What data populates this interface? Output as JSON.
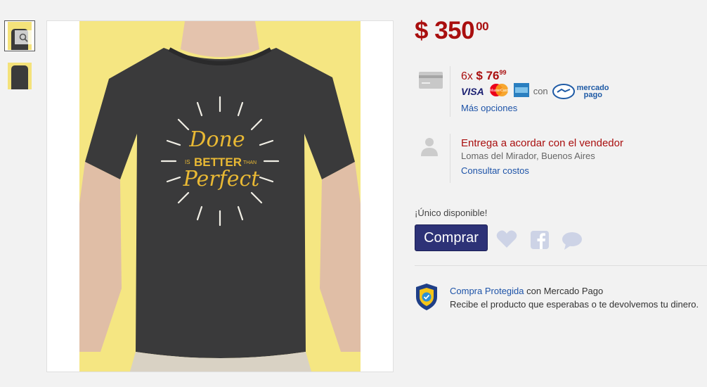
{
  "gallery": {
    "thumb_icons": [
      "magnifier-icon",
      "tshirt-thumbnail"
    ],
    "shirt_text": {
      "line1": "Done",
      "line2a": "IS",
      "line2b": "BETTER",
      "line2c": "THAN",
      "line3": "Perfect"
    }
  },
  "price": {
    "currency": "$",
    "amount": "350",
    "cents": "00"
  },
  "installments": {
    "count": "6x",
    "currency": "$",
    "amount": "76",
    "cents": "99",
    "with_label": "con",
    "mp_line1": "mercado",
    "mp_line2": "pago",
    "cards": [
      "VISA",
      "MasterCard",
      "American Express"
    ],
    "more_options": "Más opciones"
  },
  "shipping": {
    "title": "Entrega a acordar con el vendedor",
    "location": "Lomas del Mirador, Buenos Aires",
    "costs_link": "Consultar costos"
  },
  "availability": "¡Único disponible!",
  "buy_button": "Comprar",
  "protection": {
    "link": "Compra Protegida",
    "suffix": "con Mercado Pago",
    "line2": "Recibe el producto que esperabas o te devolvemos tu dinero."
  },
  "colors": {
    "price": "#a90f0f",
    "link": "#1d53a8",
    "buy": "#2d3277"
  }
}
